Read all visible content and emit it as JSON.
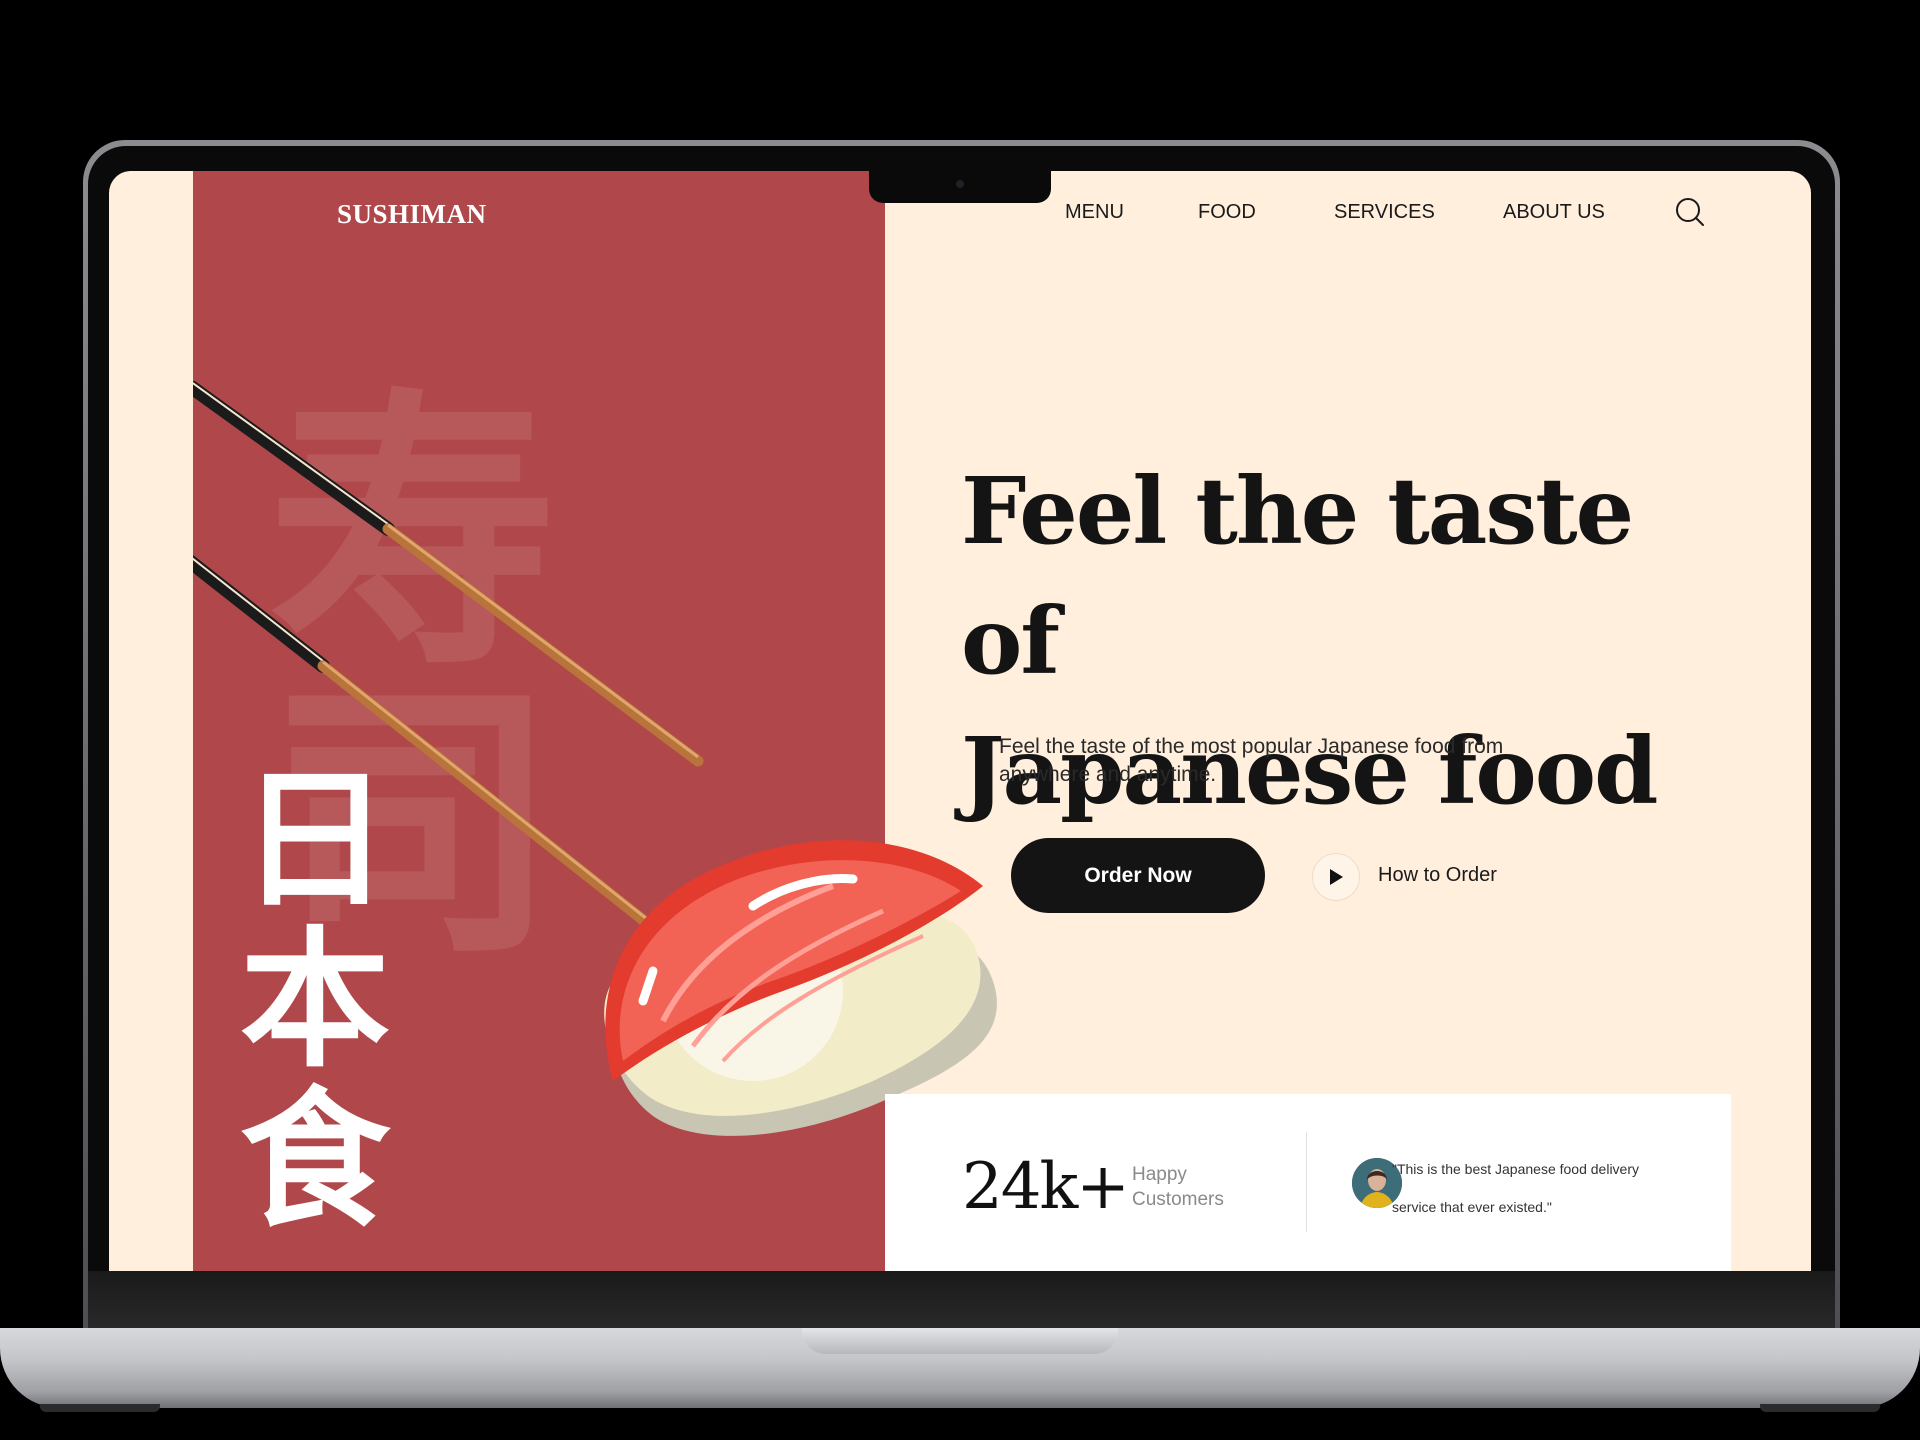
{
  "brand": {
    "logo": "SUSHIMAN"
  },
  "nav": {
    "items": [
      "MENU",
      "FOOD",
      "SERVICES",
      "ABOUT US"
    ]
  },
  "hero": {
    "title_line1": "Feel the taste of",
    "title_line2": "Japanese food",
    "subtitle": "Feel the taste of the most popular Japanese food from anywhere and anytime.",
    "order_button": "Order Now",
    "how_to_order": "How to Order"
  },
  "side_text": {
    "vertical_kanji": [
      "日",
      "本",
      "食"
    ],
    "background_kanji": "寿 司"
  },
  "stats": {
    "number": "24k+",
    "label_line1": "Happy",
    "label_line2": "Customers",
    "quote": "\"This is the best Japanese food delivery service that ever existed.\""
  },
  "colors": {
    "accent_red": "#b0484b",
    "cream": "#ffefdc",
    "dark": "#141414"
  },
  "icons": {
    "search": "search-icon",
    "play": "play-icon"
  }
}
